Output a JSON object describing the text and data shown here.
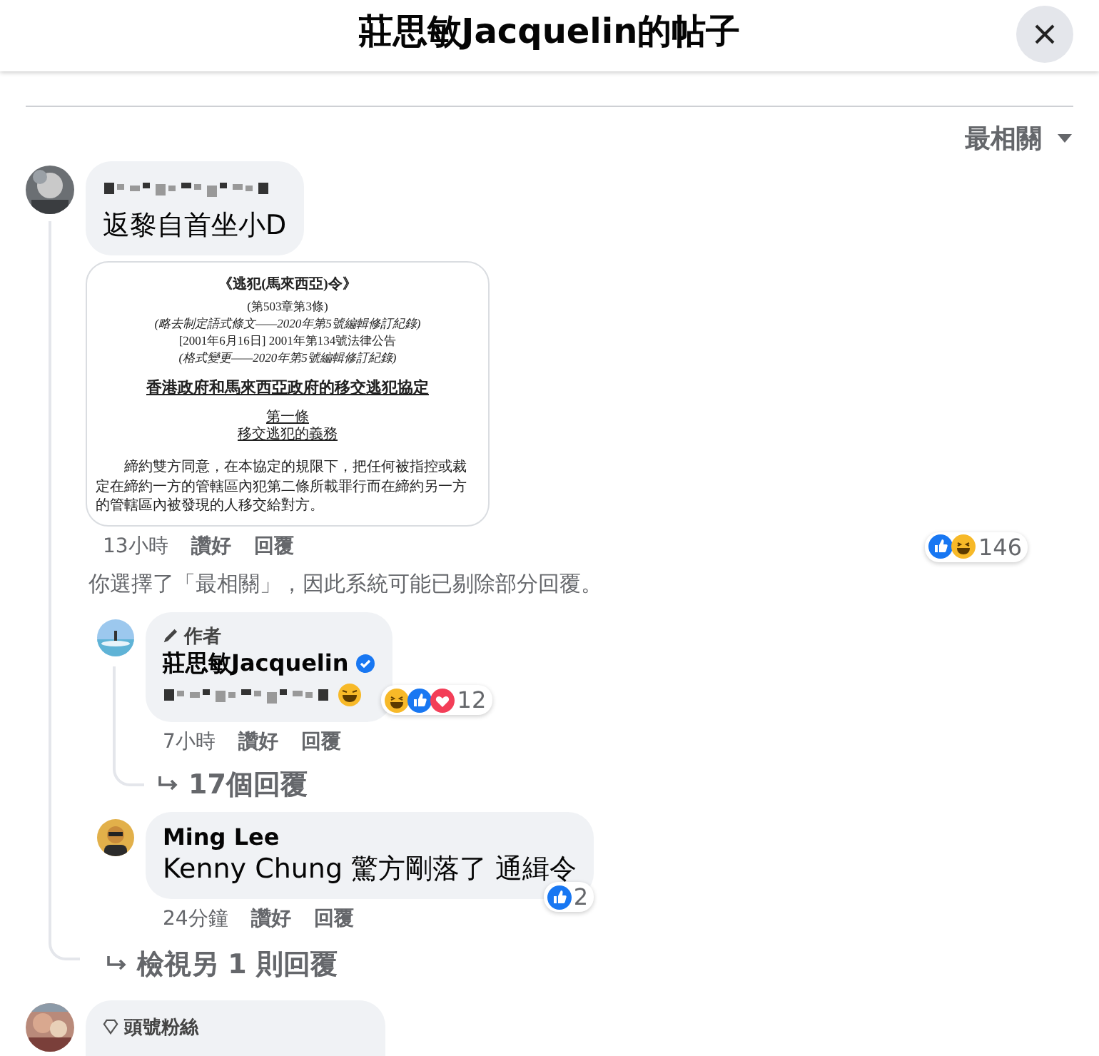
{
  "header": {
    "title": "莊思敏Jacquelin的帖子"
  },
  "sort": {
    "label": "最相關"
  },
  "comments": [
    {
      "name_redacted": true,
      "text": "返黎自首坐小D",
      "attachment": {
        "lines": [
          {
            "kind": "title",
            "text": "《逃犯(馬來西亞)令》"
          },
          {
            "kind": "small",
            "text": "(第503章第3條)"
          },
          {
            "kind": "italic",
            "text": "(略去制定語式條文——2020年第5號編輯修訂紀錄)"
          },
          {
            "kind": "small",
            "text": "[2001年6月16日] 2001年第134號法律公告"
          },
          {
            "kind": "italic",
            "text": "(格式變更——2020年第5號編輯修訂紀錄)"
          },
          {
            "kind": "heading",
            "text": "香港政府和馬來西亞政府的移交逃犯協定"
          },
          {
            "kind": "article",
            "text": "第一條"
          },
          {
            "kind": "article",
            "text": "移交逃犯的義務"
          },
          {
            "kind": "body",
            "text": "締約雙方同意，在本協定的規限下，把任何被指控或裁定在締約一方的管轄區內犯第二條所載罪行而在締約另一方的管轄區內被發現的人移交給對方。"
          }
        ]
      },
      "time": "13小時",
      "like": "讚好",
      "reply": "回覆",
      "reactions": [
        {
          "kind": "like"
        },
        {
          "kind": "haha"
        }
      ],
      "reaction_count": "146",
      "notice": "你選擇了「最相關」，因此系統可能已剔除部分回覆。",
      "replies": [
        {
          "badge": {
            "kind": "author",
            "label": "作者"
          },
          "name": "莊思敏Jacquelin",
          "verified": true,
          "text_redacted": true,
          "time": "7小時",
          "like": "讚好",
          "reply": "回覆",
          "reactions": [
            {
              "kind": "haha"
            },
            {
              "kind": "like"
            },
            {
              "kind": "love"
            }
          ],
          "reaction_count": "12",
          "more": "17個回覆"
        },
        {
          "name": "Ming Lee",
          "verified": false,
          "text": "Kenny Chung 驚方剛落了 通緝令",
          "time": "24分鐘",
          "like": "讚好",
          "reply": "回覆",
          "reactions": [
            {
              "kind": "like"
            }
          ],
          "reaction_count": "2"
        }
      ],
      "more_replies": "檢視另 1 則回覆"
    },
    {
      "badge": {
        "kind": "fan",
        "label": "頭號粉絲"
      }
    }
  ]
}
